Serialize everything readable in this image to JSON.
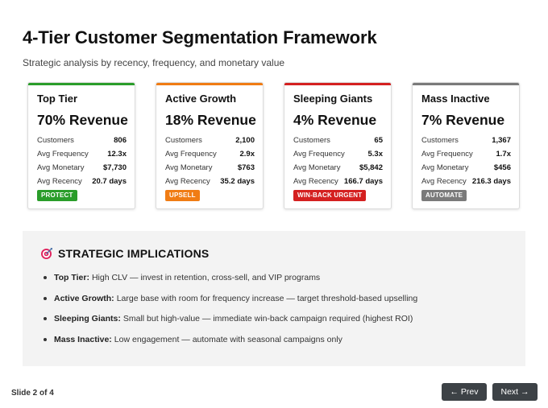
{
  "header": {
    "title": "4-Tier Customer Segmentation Framework",
    "subtitle": "Strategic analysis by recency, frequency, and monetary value"
  },
  "metric_labels": {
    "customers": "Customers",
    "frequency": "Avg Frequency",
    "monetary": "Avg Monetary",
    "recency": "Avg Recency"
  },
  "tiers": [
    {
      "name": "Top Tier",
      "revenue": "70% Revenue",
      "customers": "806",
      "frequency": "12.3x",
      "monetary": "$7,730",
      "recency": "20.7 days",
      "badge": "PROTECT",
      "accent": "#2a9d2a"
    },
    {
      "name": "Active Growth",
      "revenue": "18% Revenue",
      "customers": "2,100",
      "frequency": "2.9x",
      "monetary": "$763",
      "recency": "35.2 days",
      "badge": "UPSELL",
      "accent": "#f07c14"
    },
    {
      "name": "Sleeping Giants",
      "revenue": "4% Revenue",
      "customers": "65",
      "frequency": "5.3x",
      "monetary": "$5,842",
      "recency": "166.7 days",
      "badge": "WIN-BACK URGENT",
      "accent": "#d42020"
    },
    {
      "name": "Mass Inactive",
      "revenue": "7% Revenue",
      "customers": "1,367",
      "frequency": "1.7x",
      "monetary": "$456",
      "recency": "216.3 days",
      "badge": "AUTOMATE",
      "accent": "#7a7a7a"
    }
  ],
  "implications": {
    "title": "STRATEGIC IMPLICATIONS",
    "icon": "target-icon",
    "items": [
      {
        "term": "Top Tier:",
        "text": "High CLV — invest in retention, cross-sell, and VIP programs"
      },
      {
        "term": "Active Growth:",
        "text": "Large base with room for frequency increase — target threshold-based upselling"
      },
      {
        "term": "Sleeping Giants:",
        "text": "Small but high-value — immediate win-back campaign required (highest ROI)"
      },
      {
        "term": "Mass Inactive:",
        "text": "Low engagement — automate with seasonal campaigns only"
      }
    ]
  },
  "footer": {
    "slide_indicator": "Slide 2 of 4",
    "prev_label": "← Prev",
    "next_label": "Next →"
  }
}
